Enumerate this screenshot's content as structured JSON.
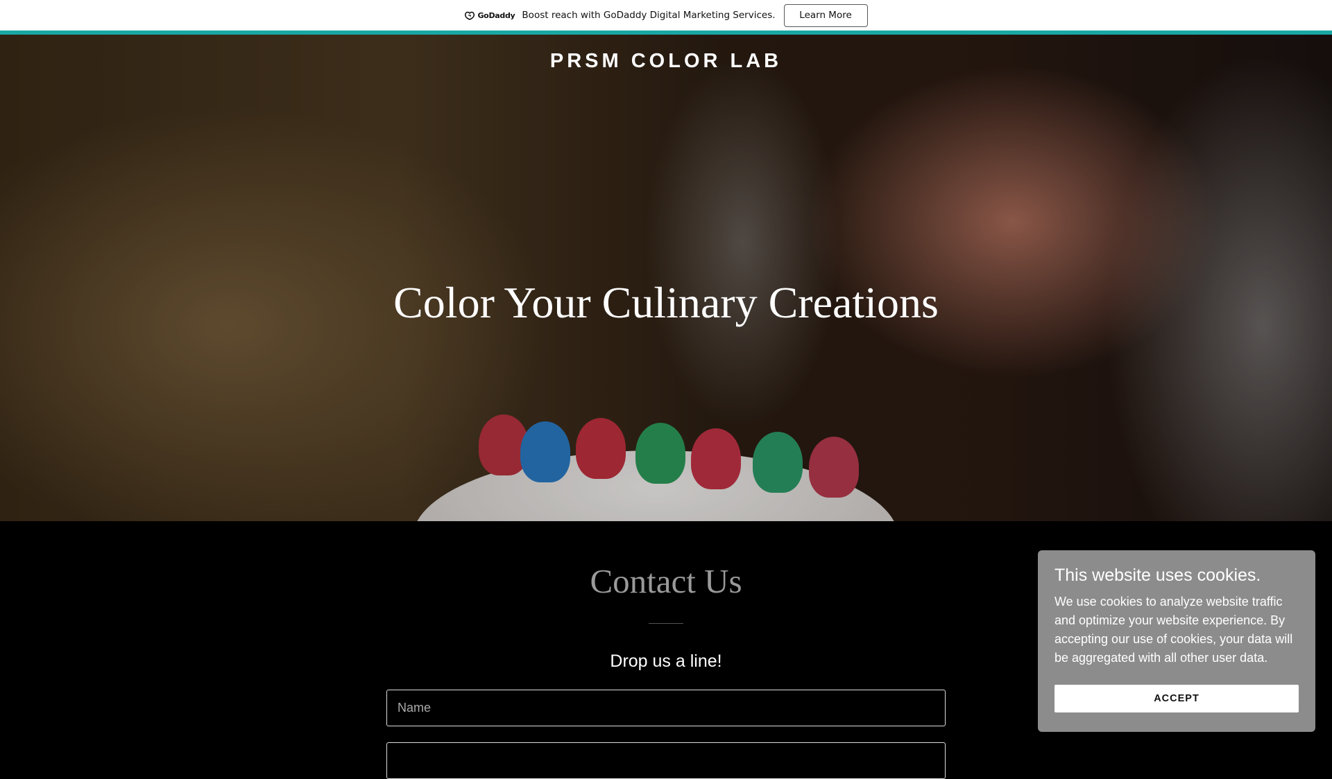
{
  "promo": {
    "logo_text": "GoDaddy",
    "message": "Boost reach with GoDaddy Digital Marketing Services.",
    "button_label": "Learn More",
    "stripe_color": "#19a7a3"
  },
  "hero": {
    "site_title": "PRSM COLOR LAB",
    "heading": "Color Your Culinary Creations"
  },
  "contact": {
    "title": "Contact Us",
    "subtitle": "Drop us a line!",
    "name_placeholder": "Name"
  },
  "cookie": {
    "title": "This website uses cookies.",
    "text": "We use cookies to analyze website traffic and optimize your website experience. By accepting our use of cookies, your data will be aggregated with all other user data.",
    "accept_label": "ACCEPT"
  }
}
